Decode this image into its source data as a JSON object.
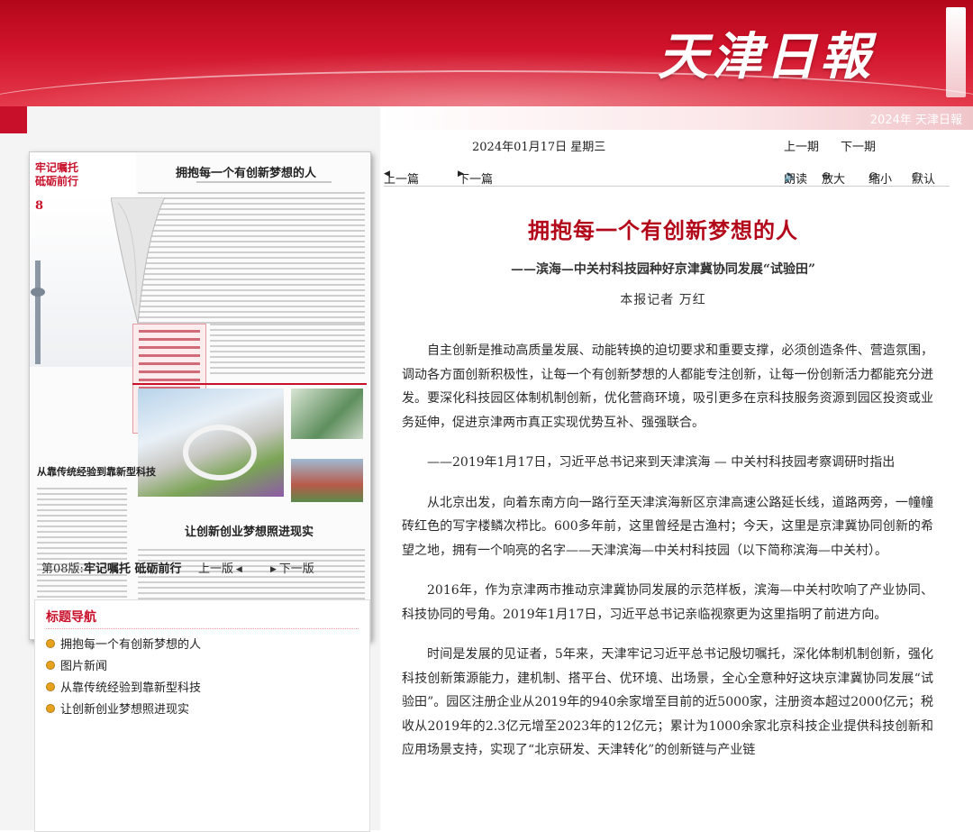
{
  "masthead": "天津日報",
  "banner_faint": "2024年  天津日報",
  "thumbnail": {
    "corner_title_1": "牢记嘱托",
    "corner_title_2": "砥砺前行",
    "page_num": "8",
    "headline_1": "拥抱每一个有创新梦想的人",
    "headline_2": "从靠传统经验到靠新型科技",
    "headline_3": "让创新创业梦想照进现实"
  },
  "edition": {
    "label": "第08版:",
    "title": "牢记嘱托  砥砺前行",
    "prev": "上一版",
    "next": "下一版"
  },
  "title_nav": {
    "heading": "标题导航",
    "items": [
      "拥抱每一个有创新梦想的人",
      "图片新闻",
      "从靠传统经验到靠新型科技",
      "让创新创业梦想照进现实"
    ]
  },
  "date": "2024年01月17日  星期三",
  "issue_nav": {
    "prev": "上一期",
    "next": "下一期"
  },
  "article_nav": {
    "prev": "上一篇",
    "next": "下一篇"
  },
  "tools": {
    "read": "朗读",
    "zoom_in": "放大",
    "zoom_out": "缩小",
    "default": "默认"
  },
  "article": {
    "title": "拥抱每一个有创新梦想的人",
    "subtitle": "——滨海—中关村科技园种好京津冀协同发展“试验田”",
    "byline": "本报记者  万红",
    "paragraphs": [
      "自主创新是推动高质量发展、动能转换的迫切要求和重要支撑，必须创造条件、营造氛围，调动各方面创新积极性，让每一个有创新梦想的人都能专注创新，让每一份创新活力都能充分迸发。要深化科技园区体制机制创新，优化营商环境，吸引更多在京科技服务资源到园区投资或业务延伸，促进京津两市真正实现优势互补、强强联合。",
      "——2019年1月17日，习近平总书记来到天津滨海  —  中关村科技园考察调研时指出",
      "从北京出发，向着东南方向一路行至天津滨海新区京津高速公路延长线，道路两旁，一幢幢砖红色的写字楼鳞次栉比。600多年前，这里曾经是古渔村；今天，这里是京津冀协同创新的希望之地，拥有一个响亮的名字——天津滨海—中关村科技园（以下简称滨海—中关村）。",
      "2016年，作为京津两市推动京津冀协同发展的示范样板，滨海—中关村吹响了产业协同、科技协同的号角。2019年1月17日，习近平总书记亲临视察更为这里指明了前进方向。",
      "时间是发展的见证者，5年来，天津牢记习近平总书记殷切嘱托，深化体制机制创新，强化科技创新策源能力，建机制、搭平台、优环境、出场景，全心全意种好这块京津冀协同发展“试验田”。园区注册企业从2019年的940余家增至目前的近5000家，注册资本超过2000亿元；税收从2019年的2.3亿元增至2023年的12亿元；累计为1000余家北京科技企业提供科技创新和应用场景支持，实现了“北京研发、天津转化”的创新链与产业链"
    ]
  }
}
